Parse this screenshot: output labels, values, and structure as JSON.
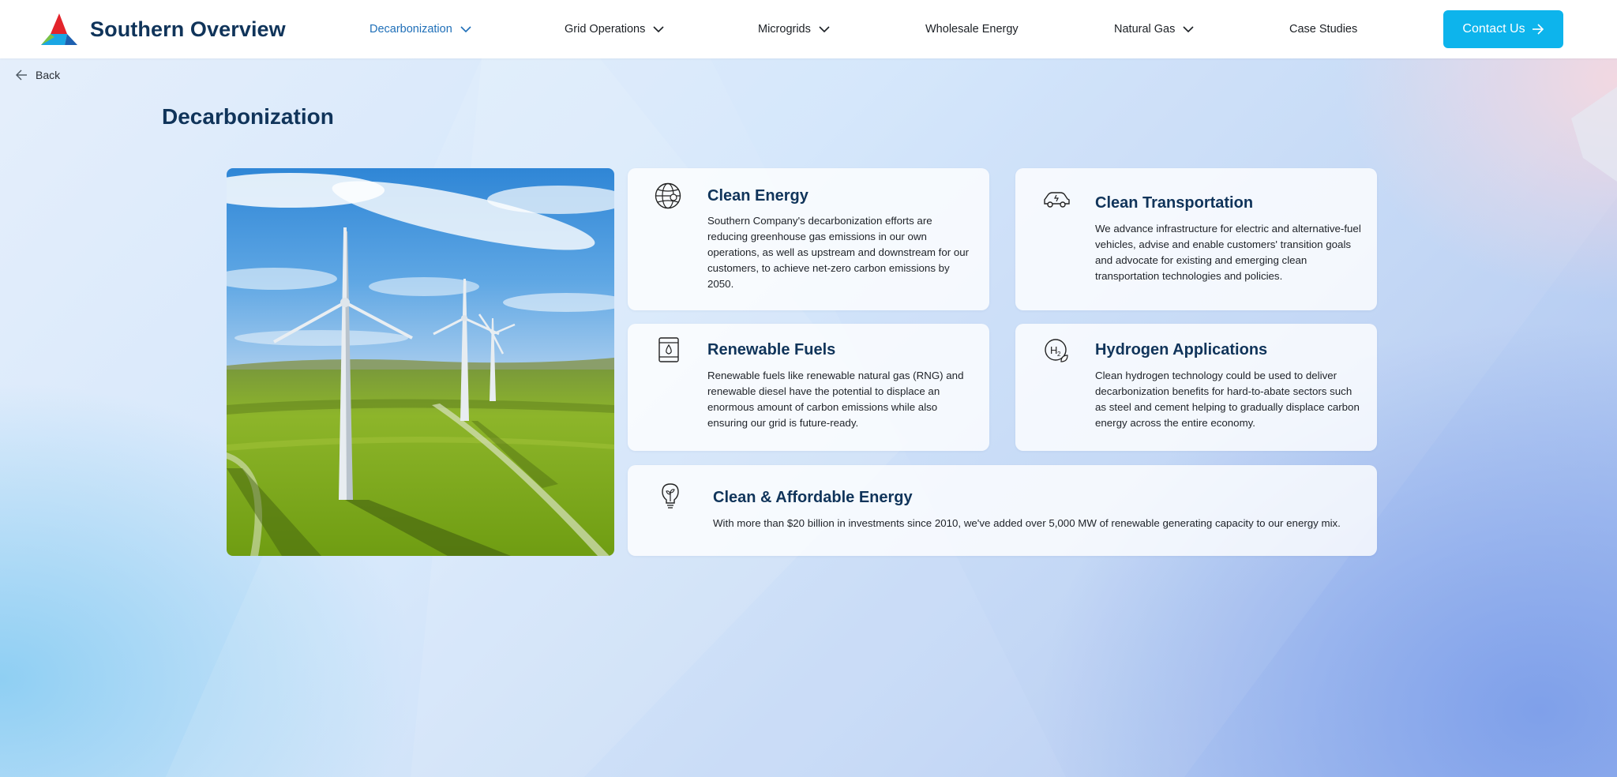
{
  "brand": {
    "name": "Southern Overview",
    "logo_colors": [
      "#e3242b",
      "#1aa6e4",
      "#7cc243",
      "#1d60b0"
    ]
  },
  "nav": {
    "items": [
      {
        "label": "Decarbonization",
        "has_dropdown": true,
        "active": true
      },
      {
        "label": "Grid Operations",
        "has_dropdown": true,
        "active": false
      },
      {
        "label": "Microgrids",
        "has_dropdown": true,
        "active": false
      },
      {
        "label": "Wholesale Energy",
        "has_dropdown": false,
        "active": false
      },
      {
        "label": "Natural Gas",
        "has_dropdown": true,
        "active": false
      },
      {
        "label": "Case Studies",
        "has_dropdown": false,
        "active": false
      }
    ],
    "contact_label": "Contact Us"
  },
  "back_label": "Back",
  "page_title": "Decarbonization",
  "hero": {
    "icon": "wind-turbines-image"
  },
  "cards": [
    {
      "icon": "globe-icon",
      "title": "Clean Energy",
      "body": "Southern Company's decarbonization efforts are reducing greenhouse gas emissions in our own operations, as well as upstream and downstream for our customers, to achieve net-zero carbon emissions by 2050."
    },
    {
      "icon": "electric-car-icon",
      "title": "Clean Transportation",
      "body": "We advance infrastructure for electric and alternative-fuel vehicles, advise and enable customers' transition goals and advocate for existing and emerging clean transportation technologies and policies."
    },
    {
      "icon": "fuel-barrel-icon",
      "title": "Renewable Fuels",
      "body": "Renewable fuels like renewable natural gas (RNG) and renewable diesel have the potential to displace an enormous amount of carbon emissions while also ensuring our grid is future-ready."
    },
    {
      "icon": "hydrogen-icon",
      "title": "Hydrogen Applications",
      "body": "Clean hydrogen technology could be used to deliver decarbonization benefits for hard-to-abate sectors such as steel and cement helping to gradually displace carbon energy across the entire economy."
    },
    {
      "icon": "eco-lightbulb-icon",
      "title": "Clean & Affordable Energy",
      "body": "With more than $20 billion in investments since 2010, we've added over 5,000 MW of renewable generating capacity to our energy mix."
    }
  ],
  "colors": {
    "accent": "#0db4ec",
    "heading": "#10345a",
    "active_nav": "#1f6fb8"
  }
}
